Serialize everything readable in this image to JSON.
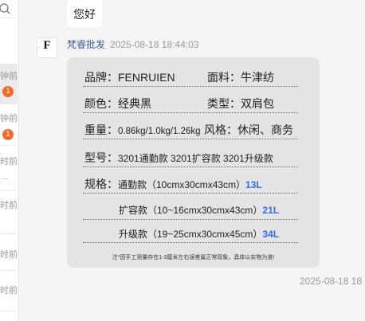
{
  "conversations": {
    "items": [
      {
        "time": "钟前",
        "badge": "1"
      },
      {
        "time": "钟前",
        "badge": "1"
      },
      {
        "time": "时前",
        "more": "..."
      },
      {
        "time": "时前"
      },
      {
        "time": "时前"
      },
      {
        "time": "时前"
      }
    ]
  },
  "chat": {
    "prev_message": "您好",
    "sender": {
      "name": "梵睿批发",
      "time": "2025-08-18 18:44:03",
      "avatar_letter": "F"
    },
    "spec_card": {
      "brand_label": "品牌：",
      "brand_value": "FENRUIEN",
      "material_label": "面料：",
      "material_value": "牛津纺",
      "color_label": "颜色：",
      "color_value": "经典黑",
      "type_label": "类型：",
      "type_value": "双肩包",
      "weight_label": "重量：",
      "weight_value": "0.86kg/1.0kg/1.26kg",
      "style_label": "风格：",
      "style_value": "休闲、商务",
      "model_label": "型号：",
      "model_value": "3201通勤款 3201扩容款 3201升级款",
      "size_label": "规格：",
      "size_rows": [
        {
          "name": "通勤款（10cmx30cmx43cm）",
          "volume": "13L"
        },
        {
          "name": "扩容款（10~16cmx30cmx43cm）",
          "volume": "21L"
        },
        {
          "name": "升级款（19~25cmx30cmx45cm）",
          "volume": "34L"
        }
      ],
      "note": "注*因手工测量存在1-3厘米左右误差属正常现象，具体以实物为准!"
    },
    "message_time": "2025-08-18 18"
  },
  "colors": {
    "accent_blue": "#2f6fe0",
    "badge": "#f56a2c",
    "sender_name": "#3b5b8f"
  }
}
